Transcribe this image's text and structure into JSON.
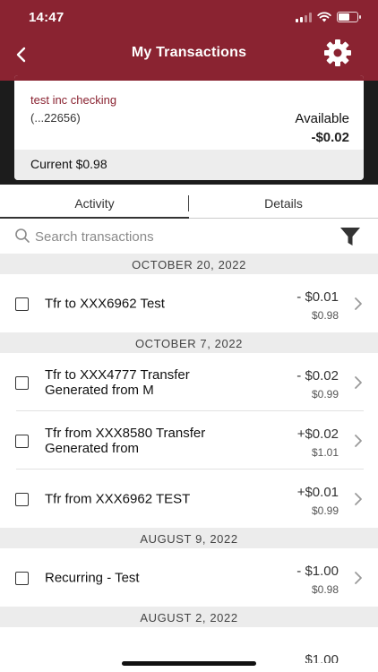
{
  "status_bar": {
    "time": "14:47"
  },
  "nav": {
    "title": "My Transactions"
  },
  "account": {
    "name": "test inc checking",
    "number": "(...22656)",
    "available_label": "Available",
    "available_value": "-$0.02",
    "current_text": "Current $0.98"
  },
  "tabs": [
    {
      "label": "Activity",
      "active": true
    },
    {
      "label": "Details",
      "active": false
    }
  ],
  "search": {
    "placeholder": "Search transactions",
    "value": ""
  },
  "groups": [
    {
      "date": "OCTOBER 20, 2022",
      "transactions": [
        {
          "desc_line1": "Tfr to XXX6962 Test",
          "desc_line2": "",
          "amount": "- $0.01",
          "balance": "$0.98"
        }
      ]
    },
    {
      "date": "OCTOBER 7, 2022",
      "transactions": [
        {
          "desc_line1": "Tfr to XXX4777 Transfer",
          "desc_line2": "Generated from M",
          "amount": "- $0.02",
          "balance": "$0.99"
        },
        {
          "desc_line1": "Tfr from XXX8580 Transfer",
          "desc_line2": "Generated from",
          "amount": "+$0.02",
          "balance": "$1.01"
        },
        {
          "desc_line1": "Tfr from XXX6962 TEST",
          "desc_line2": "",
          "amount": "+$0.01",
          "balance": "$0.99"
        }
      ]
    },
    {
      "date": "AUGUST 9, 2022",
      "transactions": [
        {
          "desc_line1": "Recurring - Test",
          "desc_line2": "",
          "amount": "- $1.00",
          "balance": "$0.98"
        }
      ]
    },
    {
      "date": "AUGUST 2, 2022",
      "transactions": [
        {
          "desc_line1": "",
          "desc_line2": "",
          "amount": "$1.00",
          "balance": ""
        }
      ]
    }
  ],
  "colors": {
    "brand": "#8a2331",
    "header_dark": "#1c1c1c",
    "date_header_bg": "#ececec"
  },
  "icons": {
    "back": "chevron-left-icon",
    "settings": "gear-icon",
    "search": "search-icon",
    "filter": "filter-icon",
    "row_chevron": "chevron-right-icon"
  }
}
